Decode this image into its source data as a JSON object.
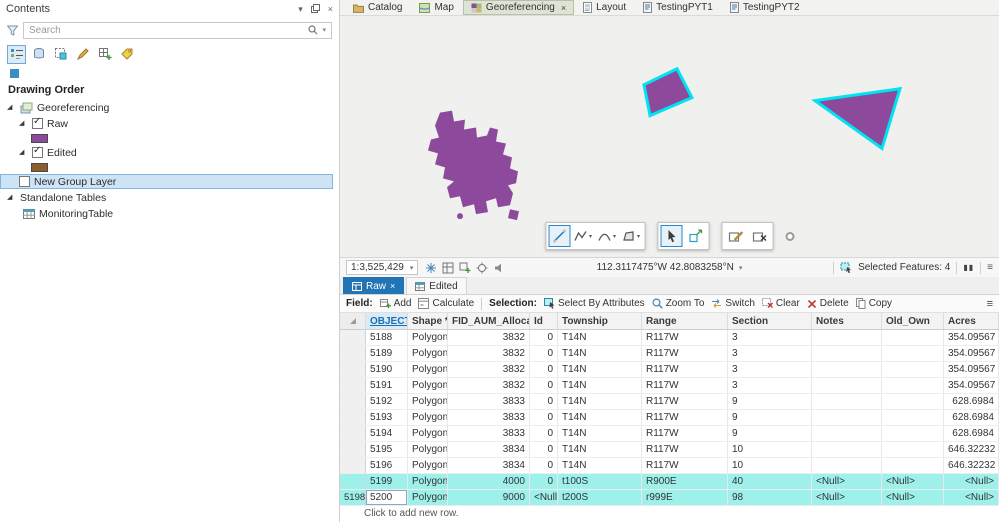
{
  "glyphs": {
    "caret": "▾",
    "close": "×",
    "menu": "≡",
    "pause": "▮▮",
    "expander": "◢",
    "check": "✓",
    "asterisk": "*"
  },
  "contents": {
    "title": "Contents",
    "search_placeholder": "Search",
    "drawing_order_label": "Drawing Order",
    "group_label": "Georeferencing",
    "layer_raw": "Raw",
    "layer_edited": "Edited",
    "new_group_layer": "New Group Layer",
    "standalone_tables": "Standalone Tables",
    "monitoring_table": "MonitoringTable",
    "raw_swatch_color": "#8d4a9c",
    "edited_swatch_color": "#8a5f2b"
  },
  "view_tabs": [
    {
      "label": "Catalog"
    },
    {
      "label": "Map"
    },
    {
      "label": "Georeferencing",
      "active": true
    },
    {
      "label": "Layout"
    },
    {
      "label": "TestingPYT1"
    },
    {
      "label": "TestingPYT2"
    }
  ],
  "statusbar": {
    "scale": "1:3,525,429",
    "coordinates": "112.3117475°W 42.8083258°N",
    "selected_features": "Selected Features: 4"
  },
  "table_tabs": {
    "raw": "Raw",
    "edited": "Edited"
  },
  "table_toolbar": {
    "field_label": "Field:",
    "add_label": "Add",
    "calculate_label": "Calculate",
    "selection_label": "Selection:",
    "select_by_attributes_label": "Select By Attributes",
    "zoom_to_label": "Zoom To",
    "switch_label": "Switch",
    "clear_label": "Clear",
    "delete_label": "Delete",
    "copy_label": "Copy"
  },
  "table": {
    "columns": [
      "OBJECTID *",
      "Shape *",
      "FID_AUM_Allocation",
      "Id",
      "Township",
      "Range",
      "Section",
      "Notes",
      "Old_Own",
      "Acres"
    ],
    "rows": [
      {
        "sel": "",
        "objectid": "5188",
        "shape": "Polygon",
        "fid": "3832",
        "id": "0",
        "township": "T14N",
        "range": "R117W",
        "section": "3",
        "notes": "",
        "old_own": "",
        "acres": "354.09567"
      },
      {
        "sel": "",
        "objectid": "5189",
        "shape": "Polygon",
        "fid": "3832",
        "id": "0",
        "township": "T14N",
        "range": "R117W",
        "section": "3",
        "notes": "",
        "old_own": "",
        "acres": "354.09567"
      },
      {
        "sel": "",
        "objectid": "5190",
        "shape": "Polygon",
        "fid": "3832",
        "id": "0",
        "township": "T14N",
        "range": "R117W",
        "section": "3",
        "notes": "",
        "old_own": "",
        "acres": "354.09567"
      },
      {
        "sel": "",
        "objectid": "5191",
        "shape": "Polygon",
        "fid": "3832",
        "id": "0",
        "township": "T14N",
        "range": "R117W",
        "section": "3",
        "notes": "",
        "old_own": "",
        "acres": "354.09567"
      },
      {
        "sel": "",
        "objectid": "5192",
        "shape": "Polygon",
        "fid": "3833",
        "id": "0",
        "township": "T14N",
        "range": "R117W",
        "section": "9",
        "notes": "",
        "old_own": "",
        "acres": "628.6984"
      },
      {
        "sel": "",
        "objectid": "5193",
        "shape": "Polygon",
        "fid": "3833",
        "id": "0",
        "township": "T14N",
        "range": "R117W",
        "section": "9",
        "notes": "",
        "old_own": "",
        "acres": "628.6984"
      },
      {
        "sel": "",
        "objectid": "5194",
        "shape": "Polygon",
        "fid": "3833",
        "id": "0",
        "township": "T14N",
        "range": "R117W",
        "section": "9",
        "notes": "",
        "old_own": "",
        "acres": "628.6984"
      },
      {
        "sel": "",
        "objectid": "5195",
        "shape": "Polygon",
        "fid": "3834",
        "id": "0",
        "township": "T14N",
        "range": "R117W",
        "section": "10",
        "notes": "",
        "old_own": "",
        "acres": "646.32232"
      },
      {
        "sel": "",
        "objectid": "5196",
        "shape": "Polygon",
        "fid": "3834",
        "id": "0",
        "township": "T14N",
        "range": "R117W",
        "section": "10",
        "notes": "",
        "old_own": "",
        "acres": "646.32232"
      },
      {
        "sel": "",
        "objectid": "5199",
        "shape": "Polygon",
        "fid": "4000",
        "id": "0",
        "township": "t100S",
        "range": "R900E",
        "section": "40",
        "notes": "<Null>",
        "old_own": "<Null>",
        "acres": "<Null>",
        "selected": true
      },
      {
        "sel": "5198",
        "objectid": "5200",
        "shape": "Polygon",
        "fid": "9000",
        "id": "<Null>",
        "township": "t200S",
        "range": "r999E",
        "section": "98",
        "notes": "<Null>",
        "old_own": "<Null>",
        "acres": "<Null>",
        "selected": true,
        "current": true,
        "active_cell": "objectid"
      }
    ],
    "add_row_hint": "Click to add new row."
  },
  "map_colors": {
    "polygon_fill": "#8d4a9c",
    "selection_outline": "#00e4f2"
  }
}
